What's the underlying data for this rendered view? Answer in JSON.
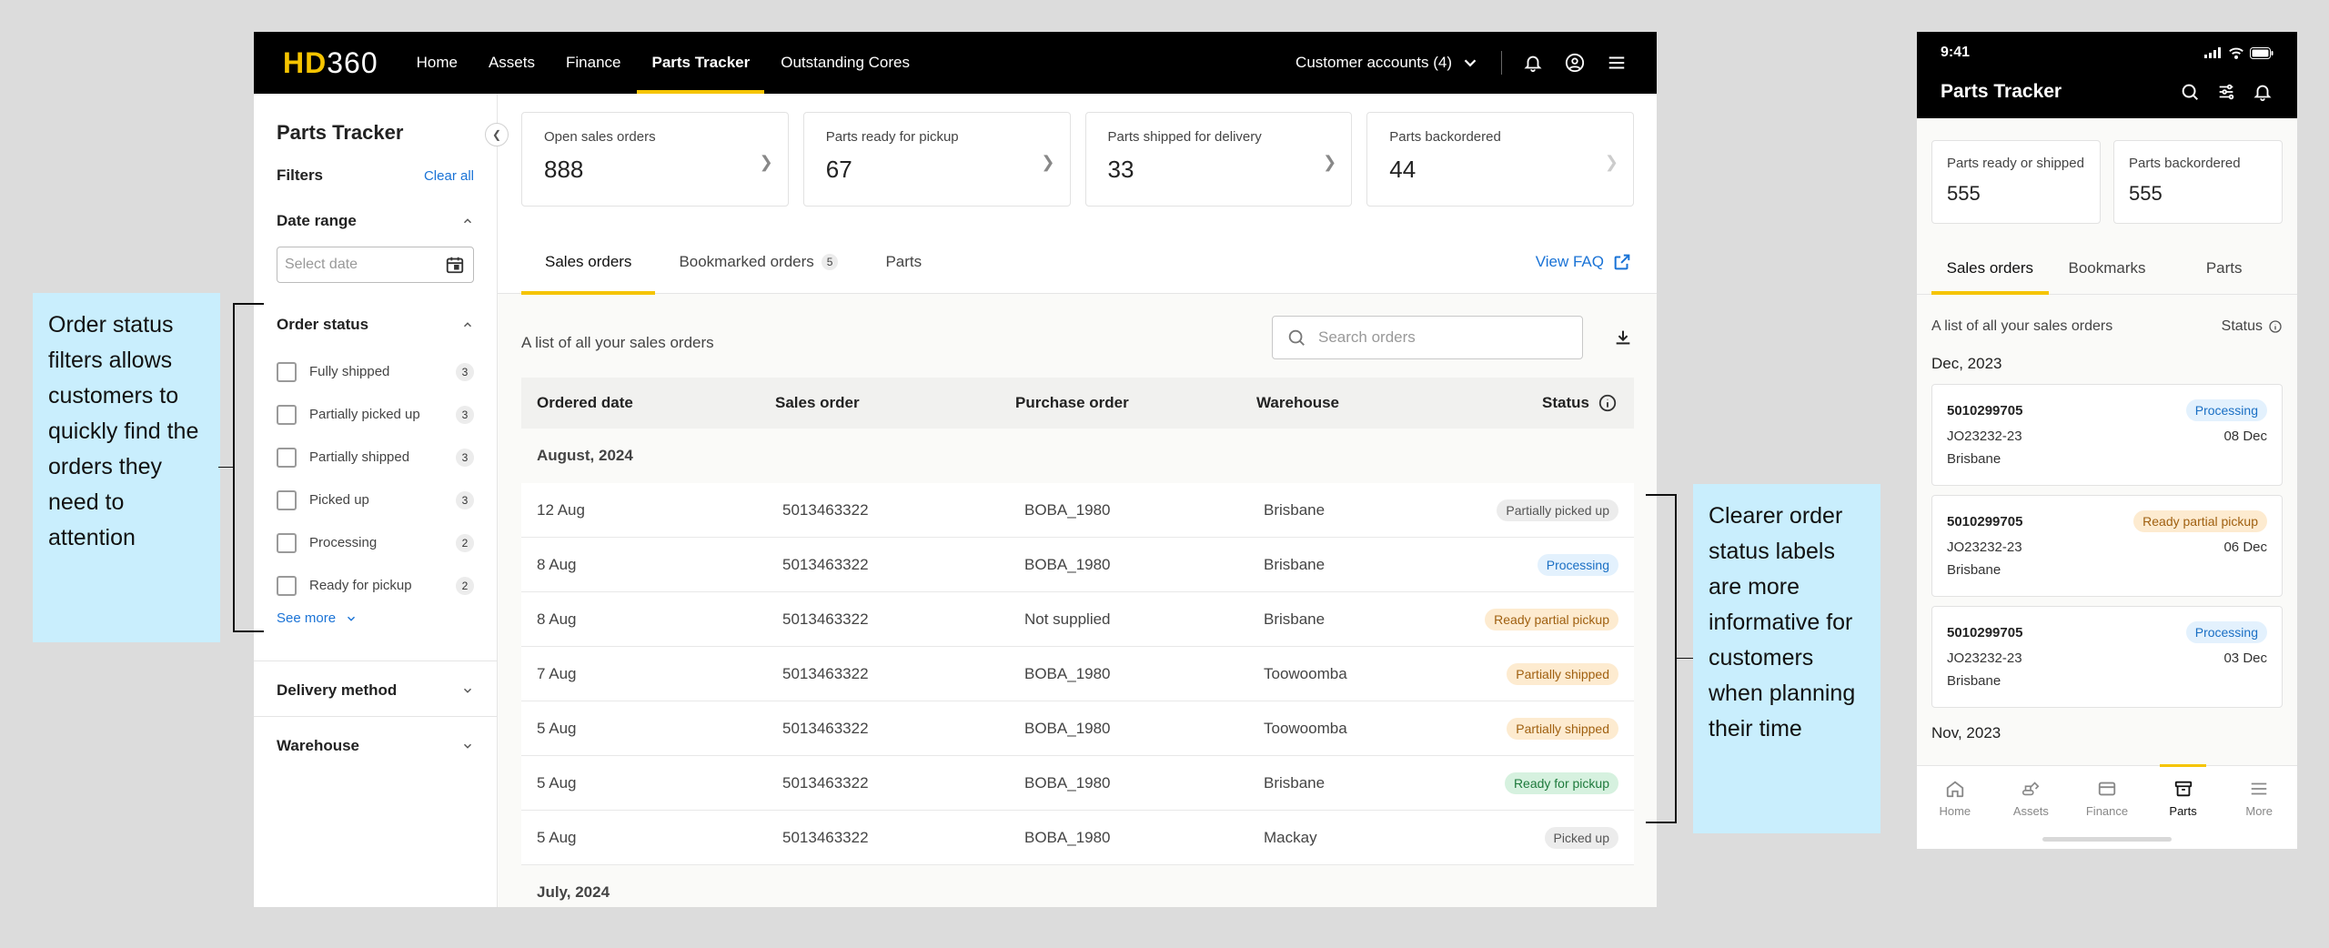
{
  "desktop": {
    "logo": {
      "hd": "HD",
      "num": "360"
    },
    "nav": [
      {
        "label": "Home"
      },
      {
        "label": "Assets"
      },
      {
        "label": "Finance"
      },
      {
        "label": "Parts Tracker"
      },
      {
        "label": "Outstanding Cores"
      }
    ],
    "accounts_label": "Customer accounts (4)",
    "sidebar": {
      "title": "Parts Tracker",
      "filters_label": "Filters",
      "clear_all": "Clear all",
      "date_range": {
        "label": "Date range",
        "placeholder": "Select date"
      },
      "order_status": {
        "label": "Order status",
        "options": [
          {
            "label": "Fully shipped",
            "count": "3"
          },
          {
            "label": "Partially picked up",
            "count": "3"
          },
          {
            "label": "Partially shipped",
            "count": "3"
          },
          {
            "label": "Picked up",
            "count": "3"
          },
          {
            "label": "Processing",
            "count": "2"
          },
          {
            "label": "Ready for pickup",
            "count": "2"
          }
        ],
        "see_more": "See more"
      },
      "delivery_method": "Delivery method",
      "warehouse": "Warehouse"
    },
    "cards": [
      {
        "label": "Open sales orders",
        "value": "888"
      },
      {
        "label": "Parts ready for pickup",
        "value": "67"
      },
      {
        "label": "Parts shipped for delivery",
        "value": "33"
      },
      {
        "label": "Parts backordered",
        "value": "44"
      }
    ],
    "tabs": {
      "sales": "Sales orders",
      "bookmarked": "Bookmarked orders",
      "bookmarked_count": "5",
      "parts": "Parts",
      "faq": "View FAQ"
    },
    "list_desc": "A list of all your sales orders",
    "search_placeholder": "Search orders",
    "table": {
      "headers": {
        "date": "Ordered date",
        "sales": "Sales order",
        "purchase": "Purchase order",
        "warehouse": "Warehouse",
        "status": "Status"
      },
      "group1": "August, 2024",
      "rows": [
        {
          "date": "12 Aug",
          "sales": "5013463322",
          "purchase": "BOBA_1980",
          "warehouse": "Brisbane",
          "status": "Partially picked up"
        },
        {
          "date": "8 Aug",
          "sales": "5013463322",
          "purchase": "BOBA_1980",
          "warehouse": "Brisbane",
          "status": "Processing"
        },
        {
          "date": "8 Aug",
          "sales": "5013463322",
          "purchase": "Not supplied",
          "warehouse": "Brisbane",
          "status": "Ready partial pickup"
        },
        {
          "date": "7 Aug",
          "sales": "5013463322",
          "purchase": "BOBA_1980",
          "warehouse": "Toowoomba",
          "status": "Partially shipped"
        },
        {
          "date": "5 Aug",
          "sales": "5013463322",
          "purchase": "BOBA_1980",
          "warehouse": "Toowoomba",
          "status": "Partially shipped"
        },
        {
          "date": "5 Aug",
          "sales": "5013463322",
          "purchase": "BOBA_1980",
          "warehouse": "Brisbane",
          "status": "Ready for pickup"
        },
        {
          "date": "5 Aug",
          "sales": "5013463322",
          "purchase": "BOBA_1980",
          "warehouse": "Mackay",
          "status": "Picked up"
        }
      ],
      "group2": "July, 2024"
    }
  },
  "status_colors": {
    "neutral": {
      "bg": "#ececec",
      "fg": "#555555"
    },
    "info": {
      "bg": "#e3f1fd",
      "fg": "#1a6fc4"
    },
    "warning": {
      "bg": "#fdebd0",
      "fg": "#a06010"
    },
    "success": {
      "bg": "#d6f1df",
      "fg": "#1e7a3c"
    }
  },
  "notes": {
    "left": "Order status filters allows customers to quickly find the orders they need to attention",
    "right": "Clearer order status labels are more informative for customers when planning their time"
  },
  "mobile": {
    "time": "9:41",
    "title": "Parts Tracker",
    "cards": [
      {
        "label": "Parts ready or shipped",
        "value": "555"
      },
      {
        "label": "Parts backordered",
        "value": "555"
      }
    ],
    "tabs": [
      "Sales orders",
      "Bookmarks",
      "Parts"
    ],
    "list_desc": "A list of all your sales orders",
    "status_label": "Status",
    "month1": "Dec, 2023",
    "orders": [
      {
        "order": "5010299705",
        "status": "Processing",
        "ref": "JO23232-23",
        "date": "08 Dec",
        "warehouse": "Brisbane"
      },
      {
        "order": "5010299705",
        "status": "Ready partial pickup",
        "ref": "JO23232-23",
        "date": "06 Dec",
        "warehouse": "Brisbane"
      },
      {
        "order": "5010299705",
        "status": "Processing",
        "ref": "JO23232-23",
        "date": "03 Dec",
        "warehouse": "Brisbane"
      }
    ],
    "month2": "Nov, 2023",
    "nav": [
      "Home",
      "Assets",
      "Finance",
      "Parts",
      "More"
    ]
  }
}
